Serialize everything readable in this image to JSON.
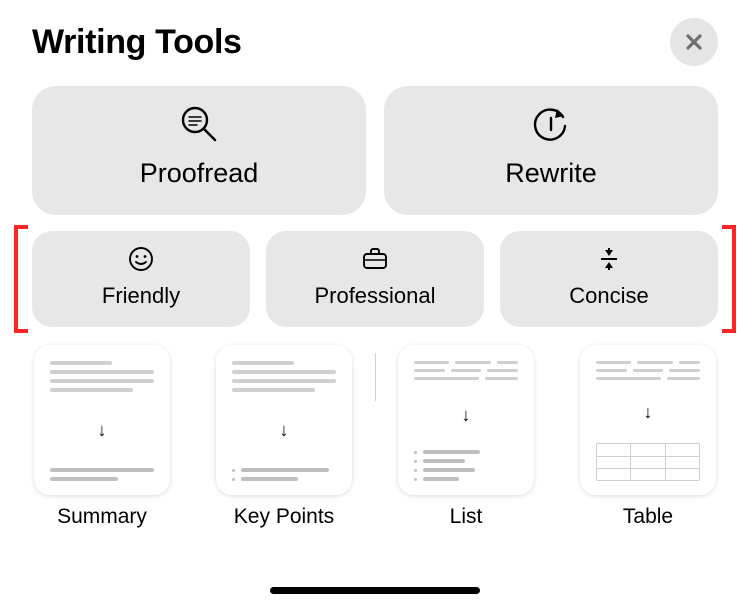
{
  "header": {
    "title": "Writing Tools"
  },
  "primary_actions": [
    {
      "id": "proofread",
      "label": "Proofread",
      "icon": "magnifier-list-icon"
    },
    {
      "id": "rewrite",
      "label": "Rewrite",
      "icon": "redo-circle-icon"
    }
  ],
  "tone_actions": [
    {
      "id": "friendly",
      "label": "Friendly",
      "icon": "smiley-icon"
    },
    {
      "id": "professional",
      "label": "Professional",
      "icon": "briefcase-icon"
    },
    {
      "id": "concise",
      "label": "Concise",
      "icon": "compress-icon"
    }
  ],
  "format_actions": [
    {
      "id": "summary",
      "label": "Summary"
    },
    {
      "id": "key-points",
      "label": "Key Points"
    },
    {
      "id": "list",
      "label": "List"
    },
    {
      "id": "table",
      "label": "Table"
    }
  ],
  "highlight_bracket_row": "tone_actions"
}
